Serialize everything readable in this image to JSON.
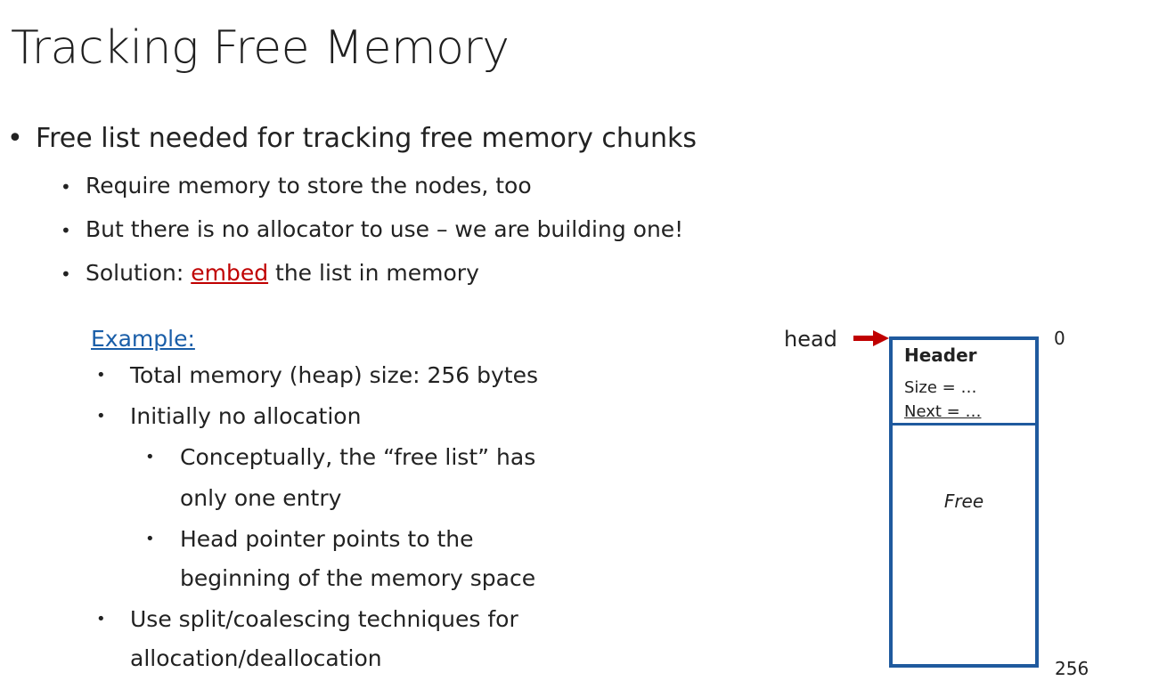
{
  "slide": {
    "title": "Tracking Free Memory",
    "bullet_main": "Free list needed for tracking free memory chunks",
    "sub_bullets": [
      "Require memory to store the nodes, too",
      "But there is no allocator to use – we are building one!"
    ],
    "solution_prefix": "Solution: ",
    "solution_highlight": "embed",
    "solution_suffix": " the list in memory",
    "example_label": "Example:",
    "example_items": {
      "total_size": "Total memory (heap) size: 256 bytes",
      "initially": "Initially no allocation",
      "conceptually_1": "Conceptually, the “free list” has",
      "conceptually_2": "only one entry",
      "head_pointer_1": "Head pointer points to the",
      "head_pointer_2": "beginning of the memory space",
      "use_split_1": "Use split/coalescing techniques for",
      "use_split_2": "allocation/deallocation"
    }
  },
  "diagram": {
    "head_label": "head",
    "header_title": "Header",
    "size_text": "Size = …",
    "next_text": "Next = …",
    "free_label": "Free",
    "addr_start": "0",
    "addr_end": "256",
    "box_color": "#1f5a9e",
    "arrow_color": "#c00000"
  }
}
